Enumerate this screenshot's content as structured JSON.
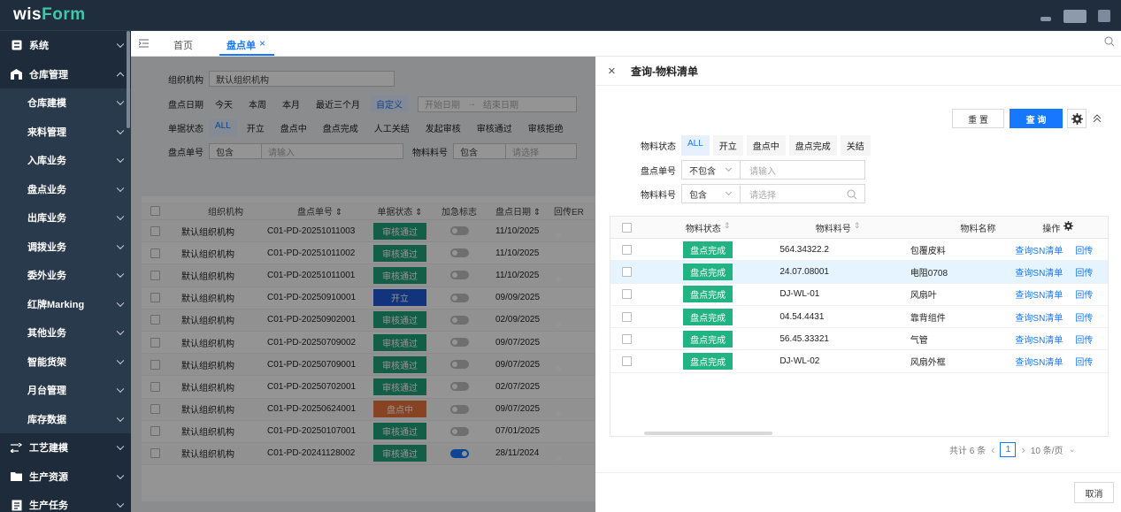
{
  "app": {
    "logo_a": "wis",
    "logo_b": "Form"
  },
  "sidebar": {
    "items": [
      {
        "label": "系统",
        "level": "top",
        "icon": "system-icon"
      },
      {
        "label": "仓库管理",
        "level": "top",
        "icon": "warehouse-icon",
        "expanded": true
      },
      {
        "label": "仓库建模",
        "level": "sub"
      },
      {
        "label": "来料管理",
        "level": "sub"
      },
      {
        "label": "入库业务",
        "level": "sub"
      },
      {
        "label": "盘点业务",
        "level": "sub"
      },
      {
        "label": "出库业务",
        "level": "sub"
      },
      {
        "label": "调拨业务",
        "level": "sub"
      },
      {
        "label": "委外业务",
        "level": "sub"
      },
      {
        "label": "红牌Marking",
        "level": "sub"
      },
      {
        "label": "其他业务",
        "level": "sub"
      },
      {
        "label": "智能货架",
        "level": "sub"
      },
      {
        "label": "月台管理",
        "level": "sub"
      },
      {
        "label": "库存数据",
        "level": "sub"
      },
      {
        "label": "工艺建模",
        "level": "top",
        "icon": "process-icon"
      },
      {
        "label": "生产资源",
        "level": "top",
        "icon": "folder-icon"
      },
      {
        "label": "生产任务",
        "level": "top",
        "icon": "task-icon"
      }
    ]
  },
  "tabs": {
    "home": "首页",
    "current": "盘点单",
    "close": "×"
  },
  "background": {
    "org_label": "组织机构",
    "org_value": "默认组织机构",
    "date_label": "盘点日期",
    "date_chips": [
      "今天",
      "本周",
      "本月",
      "最近三个月",
      "自定义"
    ],
    "date_start": "开始日期",
    "date_arrow": "→",
    "date_end": "结束日期",
    "status_label": "单据状态",
    "status_chips": [
      "ALL",
      "开立",
      "盘点中",
      "盘点完成",
      "人工关结",
      "发起审核",
      "审核通过",
      "审核拒绝"
    ],
    "no_label": "盘点单号",
    "no_op": "包含",
    "no_placeholder": "请输入",
    "mat_label": "物料料号",
    "mat_op": "包含",
    "mat_placeholder": "请选择",
    "headers": [
      "组织机构",
      "盘点单号 ⇕",
      "单据状态 ⇕",
      "加急标志",
      "盘点日期 ⇕",
      "回传ER"
    ],
    "rows": [
      {
        "org": "默认组织机构",
        "no": "C01-PD-20251011003",
        "status": "审核通过",
        "color": "#22a37a",
        "urgent": false,
        "date": "11/10/2025"
      },
      {
        "org": "默认组织机构",
        "no": "C01-PD-20251011002",
        "status": "审核通过",
        "color": "#22a37a",
        "urgent": false,
        "date": "11/10/2025"
      },
      {
        "org": "默认组织机构",
        "no": "C01-PD-20251011001",
        "status": "审核通过",
        "color": "#22a37a",
        "urgent": false,
        "date": "11/10/2025"
      },
      {
        "org": "默认组织机构",
        "no": "C01-PD-20250910001",
        "status": "开立",
        "color": "#1e5bd6",
        "urgent": false,
        "date": "09/09/2025"
      },
      {
        "org": "默认组织机构",
        "no": "C01-PD-20250902001",
        "status": "审核通过",
        "color": "#22a37a",
        "urgent": false,
        "date": "02/09/2025"
      },
      {
        "org": "默认组织机构",
        "no": "C01-PD-20250709002",
        "status": "审核通过",
        "color": "#22a37a",
        "urgent": false,
        "date": "09/07/2025"
      },
      {
        "org": "默认组织机构",
        "no": "C01-PD-20250709001",
        "status": "审核通过",
        "color": "#22a37a",
        "urgent": false,
        "date": "09/07/2025"
      },
      {
        "org": "默认组织机构",
        "no": "C01-PD-20250702001",
        "status": "审核通过",
        "color": "#22a37a",
        "urgent": false,
        "date": "02/07/2025"
      },
      {
        "org": "默认组织机构",
        "no": "C01-PD-20250624001",
        "status": "盘点中",
        "color": "#e8743b",
        "urgent": false,
        "date": "09/07/2025"
      },
      {
        "org": "默认组织机构",
        "no": "C01-PD-20250107001",
        "status": "审核通过",
        "color": "#22a37a",
        "urgent": false,
        "date": "07/01/2025"
      },
      {
        "org": "默认组织机构",
        "no": "C01-PD-20241128002",
        "status": "审核通过",
        "color": "#22a37a",
        "urgent": true,
        "date": "28/11/2024"
      }
    ]
  },
  "drawer": {
    "title": "查询-物料清单",
    "close": "×",
    "reset": "重 置",
    "query": "查 询",
    "status_label": "物料状态",
    "status_chips": [
      "ALL",
      "开立",
      "盘点中",
      "盘点完成",
      "关结"
    ],
    "no_label": "盘点单号",
    "no_op": "不包含",
    "no_placeholder": "请输入",
    "mat_label": "物料料号",
    "mat_op": "包含",
    "mat_placeholder": "请选择",
    "table": {
      "headers": {
        "status": "物料状态",
        "no": "物料料号",
        "name": "物料名称",
        "op": "操作"
      },
      "rows": [
        {
          "status": "盘点完成",
          "no": "564.34322.2",
          "name": "包覆皮料",
          "op1": "查询SN清单",
          "op2": "回传",
          "hl": false
        },
        {
          "status": "盘点完成",
          "no": "24.07.08001",
          "name": "电阻0708",
          "op1": "查询SN清单",
          "op2": "回传",
          "hl": true
        },
        {
          "status": "盘点完成",
          "no": "DJ-WL-01",
          "name": "风扇叶",
          "op1": "查询SN清单",
          "op2": "回传",
          "hl": false
        },
        {
          "status": "盘点完成",
          "no": "04.54.4431",
          "name": "靠背组件",
          "op1": "查询SN清单",
          "op2": "回传",
          "hl": false
        },
        {
          "status": "盘点完成",
          "no": "56.45.33321",
          "name": "气管",
          "op1": "查询SN清单",
          "op2": "回传",
          "hl": false
        },
        {
          "status": "盘点完成",
          "no": "DJ-WL-02",
          "name": "风扇外框",
          "op1": "查询SN清单",
          "op2": "回传",
          "hl": false
        }
      ]
    },
    "pager": {
      "total": "共计 6 条",
      "prev": "‹",
      "page": "1",
      "next": "›",
      "size": "10 条/页"
    },
    "cancel": "取消"
  }
}
